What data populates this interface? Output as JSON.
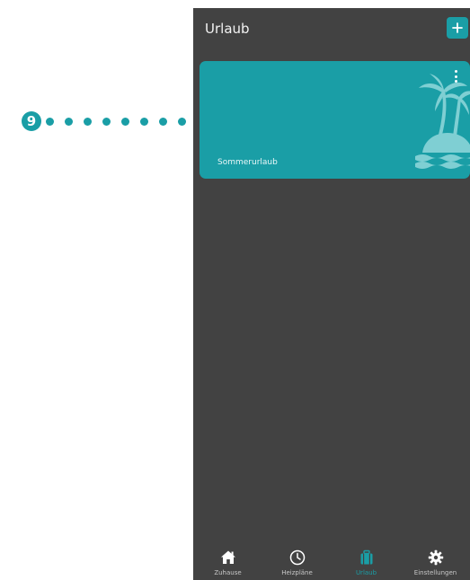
{
  "callout": {
    "number": "9"
  },
  "header": {
    "title": "Urlaub",
    "add_icon": "plus-icon"
  },
  "card": {
    "label": "Sommerurlaub",
    "menu_icon": "kebab-menu-icon",
    "illustration": "palm-island-icon"
  },
  "bottom_nav": {
    "items": [
      {
        "label": "Zuhause",
        "icon": "home-icon",
        "active": false
      },
      {
        "label": "Heizpläne",
        "icon": "clock-icon",
        "active": false
      },
      {
        "label": "Urlaub",
        "icon": "suitcase-icon",
        "active": true
      },
      {
        "label": "Einstellungen",
        "icon": "gear-icon",
        "active": false
      }
    ]
  },
  "colors": {
    "accent": "#1a9ea6",
    "background": "#424242",
    "page": "#ffffff"
  }
}
